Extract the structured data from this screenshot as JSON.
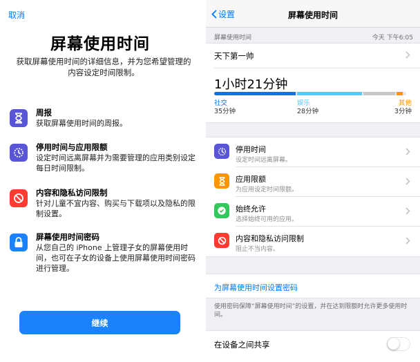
{
  "onboarding": {
    "cancel_label": "取消",
    "title": "屏幕使用时间",
    "intro": "获取屏幕使用时间的详细信息，并为您希望管理的内容设定时间限制。",
    "features": [
      {
        "title": "周报",
        "desc": "获取屏幕使用时间的周报。",
        "icon": "hourglass-icon",
        "color": "#5856d6"
      },
      {
        "title": "停用时间与应用限额",
        "desc": "设定时间远离屏幕并为需要管理的应用类别设定每日时间限制。",
        "icon": "downtime-icon",
        "color": "#5856d6"
      },
      {
        "title": "内容和隐私访问限制",
        "desc": "针对儿童不宜内容、购买与下载项以及隐私的限制设置。",
        "icon": "restriction-icon",
        "color": "#ff3b30"
      },
      {
        "title": "屏幕使用时间密码",
        "desc": "从您自己的 iPhone 上管理子女的屏幕使用时间，也可在子女的设备上使用屏幕使用时间密码进行管理。",
        "icon": "lock-icon",
        "color": "#1a82fb"
      }
    ],
    "continue_label": "继续"
  },
  "settings": {
    "back_label": "设置",
    "nav_title": "屏幕使用时间",
    "section_label": "屏幕使用时间",
    "timestamp": "今天 下午6:05",
    "device_name": "天下第一帅",
    "total_time": "1小时21分钟",
    "usage": {
      "categories": [
        {
          "name": "社交",
          "value": "35分钟",
          "minutes": 35,
          "color": "#1a6fdc"
        },
        {
          "name": "娱乐",
          "value": "28分钟",
          "minutes": 28,
          "color": "#5ac8fa"
        },
        {
          "name": "",
          "value": "",
          "minutes": 14,
          "color": "#c7c7cc"
        },
        {
          "name": "其他",
          "value": "3分钟",
          "minutes": 3,
          "color": "#ff9500"
        }
      ],
      "total_minutes": 81
    },
    "rows": [
      {
        "title": "停用时间",
        "subtitle": "设定时间远离屏幕。",
        "icon": "downtime-icon",
        "color": "#5856d6"
      },
      {
        "title": "应用限额",
        "subtitle": "为应用设定时间限额。",
        "icon": "hourglass-icon",
        "color": "#ff9500"
      },
      {
        "title": "始终允许",
        "subtitle": "选择始终可用的应用。",
        "icon": "checkmark-icon",
        "color": "#34c759"
      },
      {
        "title": "内容和隐私访问限制",
        "subtitle": "阻止不当内容。",
        "icon": "restriction-icon",
        "color": "#ff3b30"
      }
    ],
    "passcode_link": "为屏幕使用时间设置密码",
    "passcode_note": "使用密码保障“屏幕使用时间”的设置，并在达到限额时允许更多使用时间。",
    "share_label": "在设备之间共享",
    "share_enabled": false
  }
}
